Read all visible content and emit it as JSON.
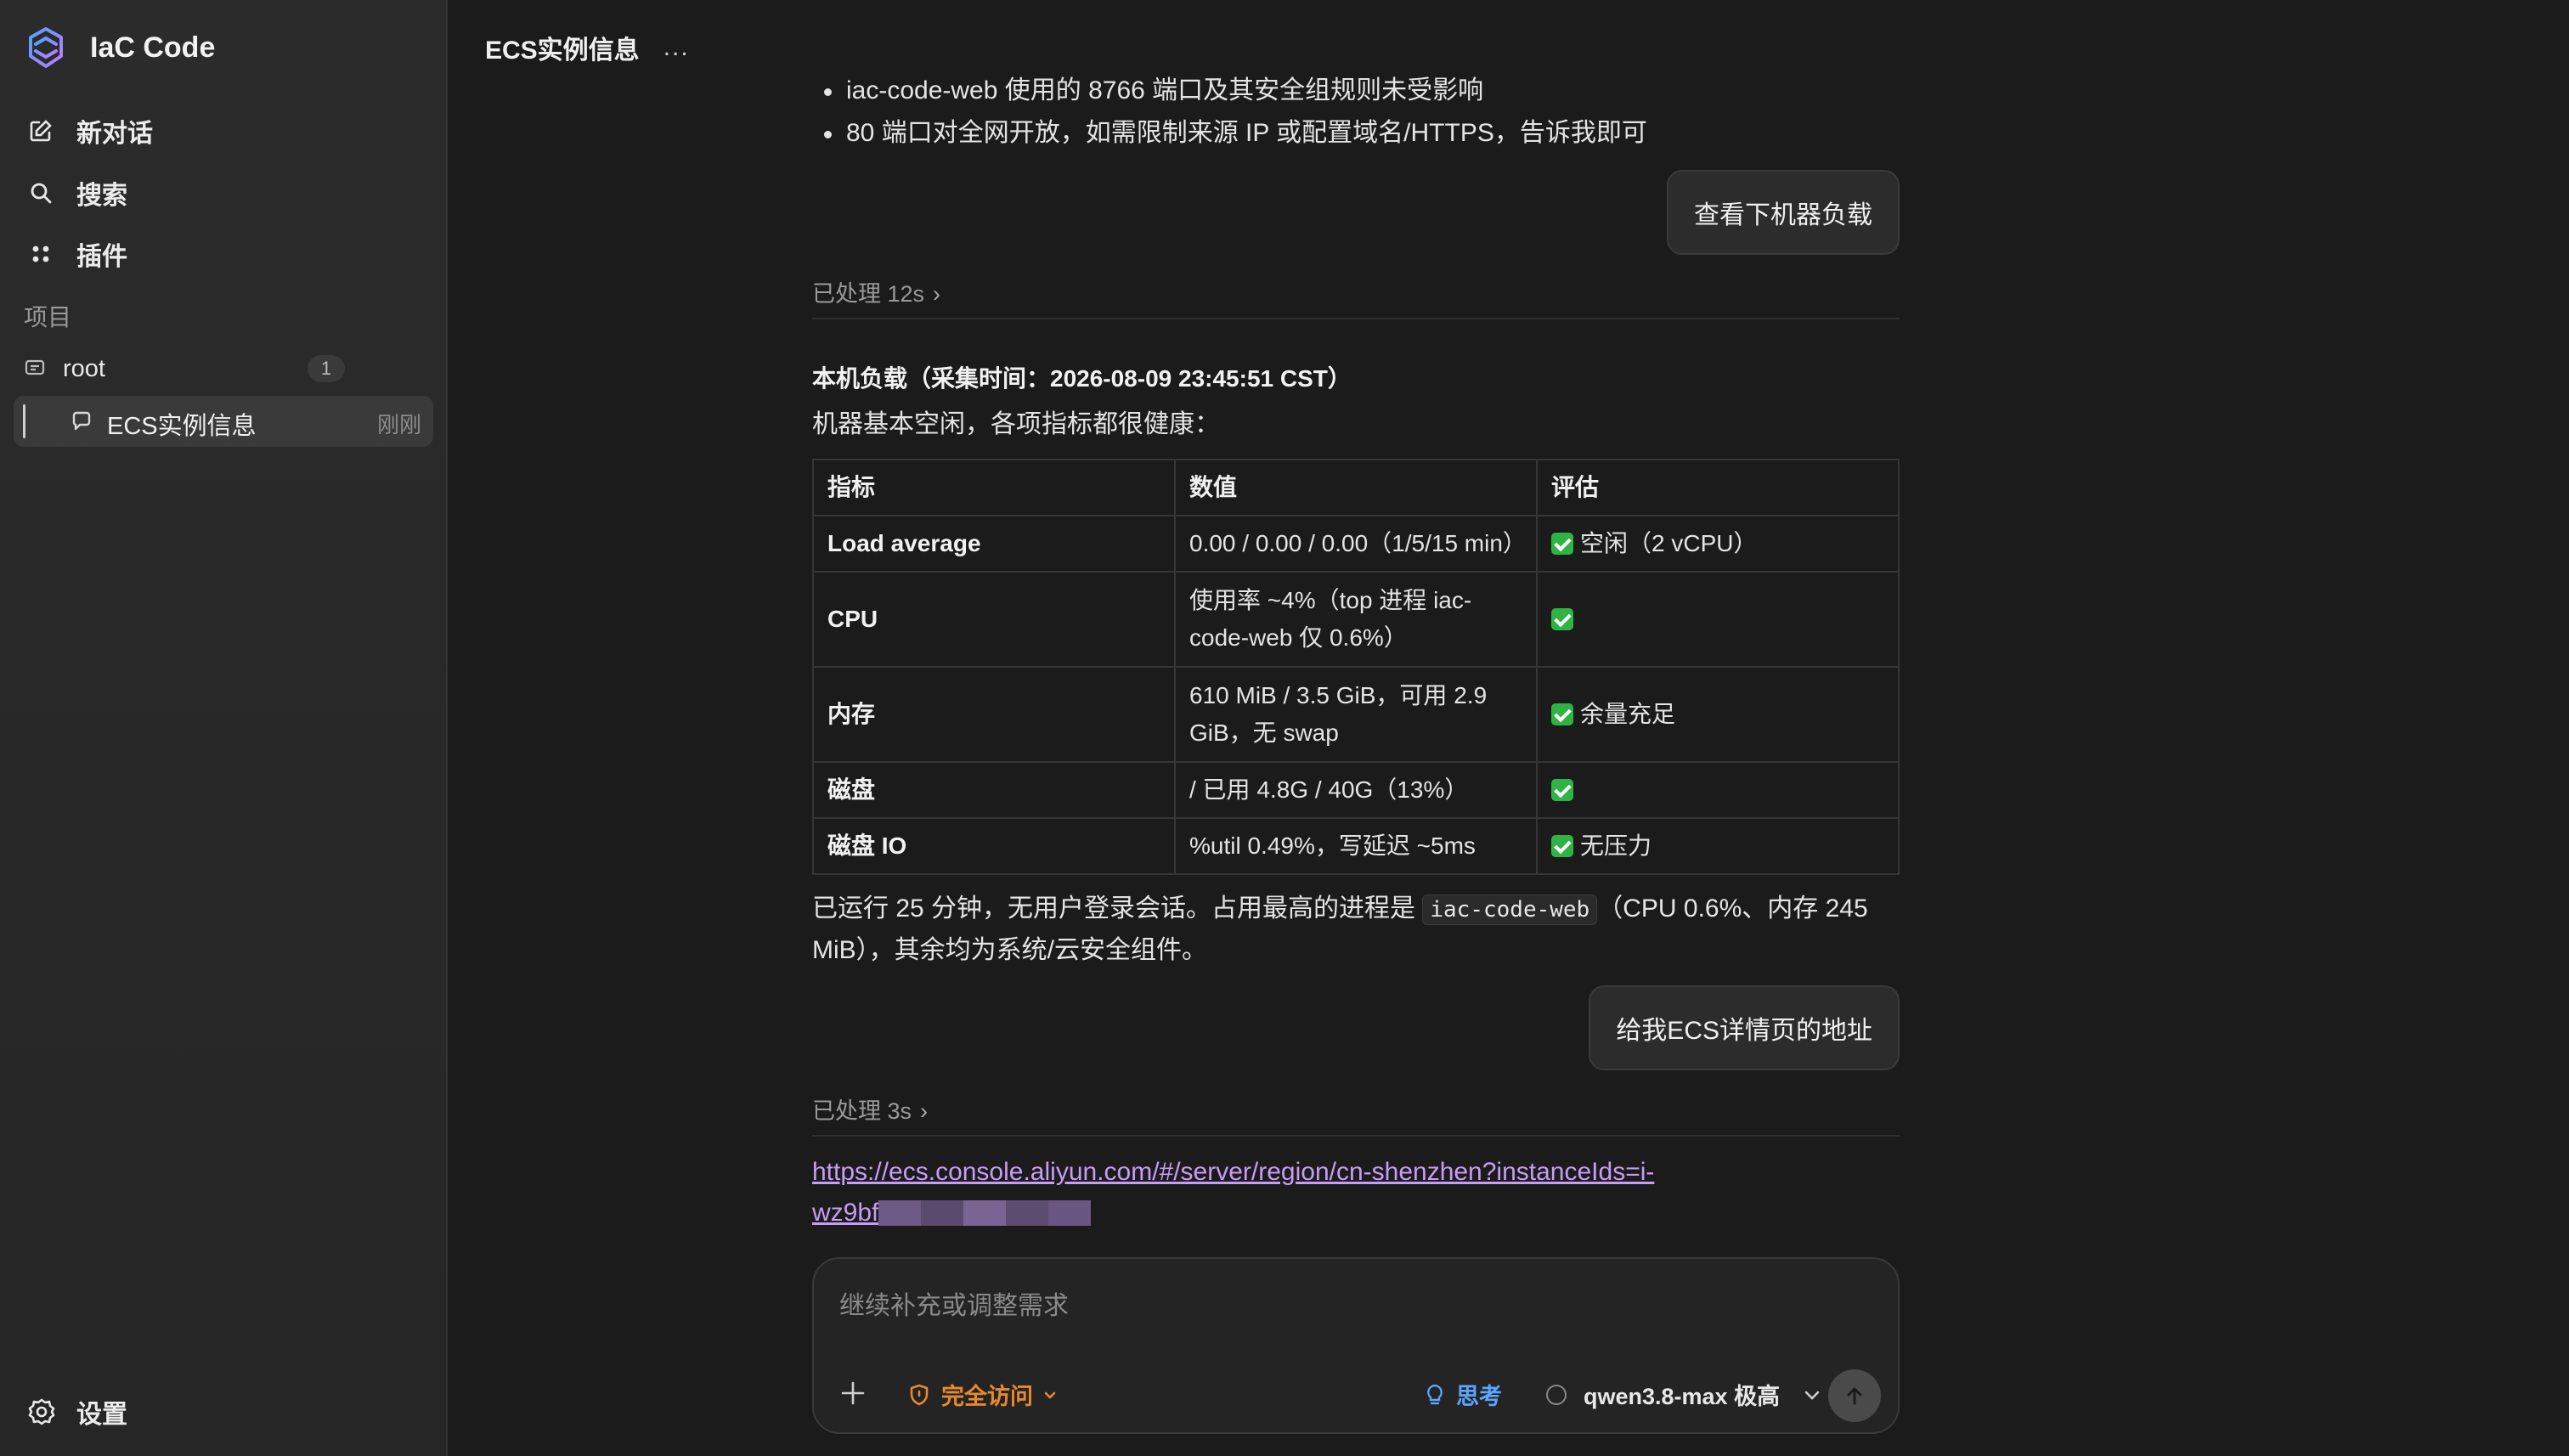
{
  "app": {
    "name": "IaC Code"
  },
  "sidebar": {
    "nav": [
      {
        "label": "新对话",
        "icon": "new-chat-icon"
      },
      {
        "label": "搜索",
        "icon": "search-icon"
      },
      {
        "label": "插件",
        "icon": "plugins-icon"
      }
    ],
    "section_title": "项目",
    "project": {
      "label": "root",
      "count": "1"
    },
    "thread": {
      "label": "ECS实例信息",
      "time": "刚刚"
    },
    "settings_label": "设置"
  },
  "topbar": {
    "title": "ECS实例信息",
    "more": "..."
  },
  "chat": {
    "bullets": [
      "iac-code-web 使用的 8766 端口及其安全组规则未受影响",
      "80 端口对全网开放，如需限制来源 IP 或配置域名/HTTPS，告诉我即可"
    ],
    "user_msg_1": "查看下机器负载",
    "processed_1": "已处理 12s",
    "heading": "本机负载（采集时间：2026-08-09 23:45:51 CST）",
    "intro": "机器基本空闲，各项指标都很健康：",
    "table": {
      "headers": [
        "指标",
        "数值",
        "评估"
      ],
      "rows": [
        {
          "name": "Load average",
          "value": "0.00 / 0.00 / 0.00（1/5/15 min）",
          "eval": "空闲（2 vCPU）"
        },
        {
          "name": "CPU",
          "value": "使用率 ~4%（top 进程 iac-code-web 仅 0.6%）",
          "eval": ""
        },
        {
          "name": "内存",
          "value": "610 MiB / 3.5 GiB，可用 2.9 GiB，无 swap",
          "eval": "余量充足"
        },
        {
          "name": "磁盘",
          "value": "/ 已用 4.8G / 40G（13%）",
          "eval": ""
        },
        {
          "name": "磁盘 IO",
          "value": "%util 0.49%，写延迟 ~5ms",
          "eval": "无压力"
        }
      ]
    },
    "summary_before": "已运行 25 分钟，无用户登录会话。占用最高的进程是 ",
    "summary_code": "iac-code-web",
    "summary_after": "（CPU 0.6%、内存 245 MiB），其余均为系统/云安全组件。",
    "user_msg_2": "给我ECS详情页的地址",
    "processed_2": "已处理 3s",
    "link_text_1": "https://ecs.console.aliyun.com/#/server/region/cn-shenzhen?instanceIds=i-",
    "link_text_2": "wz9bf"
  },
  "composer": {
    "placeholder": "继续补充或调整需求",
    "access_label": "完全访问",
    "think_label": "思考",
    "model_label": "qwen3.8-max 极高"
  },
  "colors": {
    "background": "#1b1b1b",
    "sidebar": "#2a2a2a",
    "link": "#c79cf5",
    "access": "#e8892f",
    "think": "#5aa6ff",
    "check": "#2fb344"
  }
}
